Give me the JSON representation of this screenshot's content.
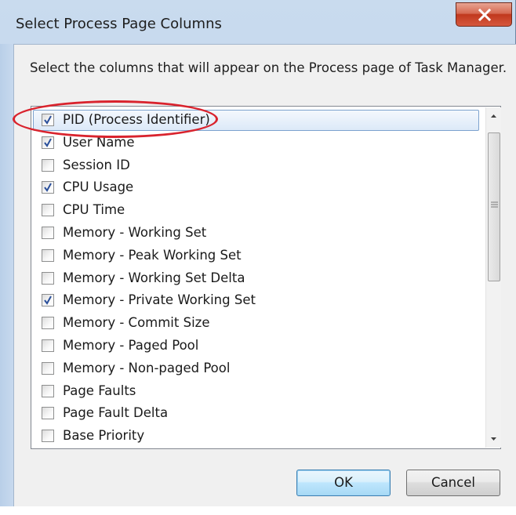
{
  "dialog": {
    "title": "Select Process Page Columns",
    "description": "Select the columns that will appear on the Process page of Task Manager.",
    "close_icon": "close-x-icon"
  },
  "columns": [
    {
      "label": "PID (Process Identifier)",
      "checked": true,
      "selected": true
    },
    {
      "label": "User Name",
      "checked": true,
      "selected": false
    },
    {
      "label": "Session ID",
      "checked": false,
      "selected": false
    },
    {
      "label": "CPU Usage",
      "checked": true,
      "selected": false
    },
    {
      "label": "CPU Time",
      "checked": false,
      "selected": false
    },
    {
      "label": "Memory - Working Set",
      "checked": false,
      "selected": false
    },
    {
      "label": "Memory - Peak Working Set",
      "checked": false,
      "selected": false
    },
    {
      "label": "Memory - Working Set Delta",
      "checked": false,
      "selected": false
    },
    {
      "label": "Memory - Private Working Set",
      "checked": true,
      "selected": false
    },
    {
      "label": "Memory - Commit Size",
      "checked": false,
      "selected": false
    },
    {
      "label": "Memory - Paged Pool",
      "checked": false,
      "selected": false
    },
    {
      "label": "Memory - Non-paged Pool",
      "checked": false,
      "selected": false
    },
    {
      "label": "Page Faults",
      "checked": false,
      "selected": false
    },
    {
      "label": "Page Fault Delta",
      "checked": false,
      "selected": false
    },
    {
      "label": "Base Priority",
      "checked": false,
      "selected": false
    }
  ],
  "buttons": {
    "ok": "OK",
    "cancel": "Cancel"
  },
  "colors": {
    "annotation": "#d9232d",
    "checkmark": "#2a4f9a",
    "close_button": "#c0381d"
  }
}
